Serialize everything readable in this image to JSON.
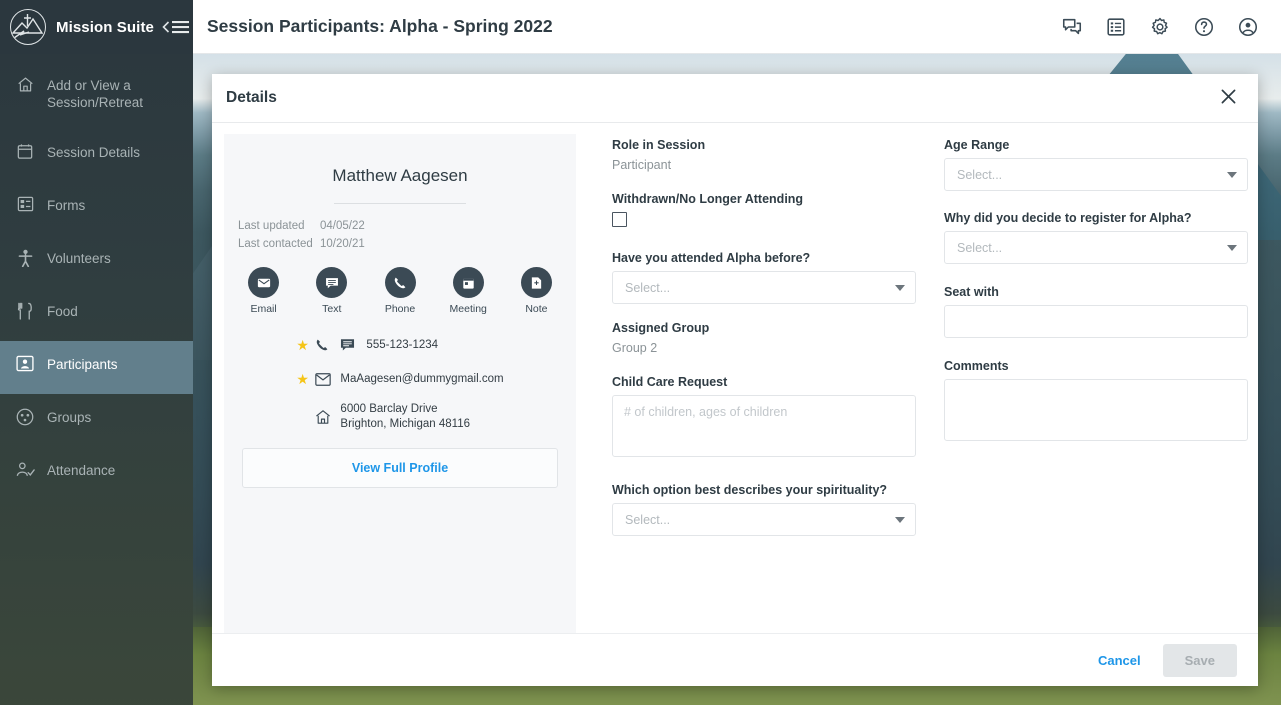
{
  "brand": {
    "name": "Mission Suite",
    "logo_icon": "mountain-cross-logo",
    "collapse_icon": "collapse-sidebar-icon"
  },
  "sidebar": {
    "items": [
      {
        "label": "Add or View a Session/Retreat",
        "icon": "home-icon",
        "active": false
      },
      {
        "label": "Session Details",
        "icon": "calendar-icon",
        "active": false
      },
      {
        "label": "Forms",
        "icon": "form-icon",
        "active": false
      },
      {
        "label": "Volunteers",
        "icon": "volunteer-person-icon",
        "active": false
      },
      {
        "label": "Food",
        "icon": "fork-knife-icon",
        "active": false
      },
      {
        "label": "Participants",
        "icon": "participant-badge-icon",
        "active": true
      },
      {
        "label": "Groups",
        "icon": "groups-circle-icon",
        "active": false
      },
      {
        "label": "Attendance",
        "icon": "attendance-check-icon",
        "active": false
      }
    ]
  },
  "header": {
    "title": "Session Participants: Alpha - Spring 2022",
    "actions": [
      {
        "icon": "chat-icon"
      },
      {
        "icon": "list-report-icon"
      },
      {
        "icon": "gear-icon"
      },
      {
        "icon": "help-icon"
      },
      {
        "icon": "account-icon"
      }
    ]
  },
  "modal": {
    "title": "Details",
    "close_icon": "close-icon",
    "footer": {
      "cancel_label": "Cancel",
      "save_label": "Save"
    }
  },
  "profile": {
    "name": "Matthew Aagesen",
    "meta": [
      {
        "key": "Last updated",
        "value": "04/05/22"
      },
      {
        "key": "Last contacted",
        "value": "10/20/21"
      }
    ],
    "quick_actions": [
      {
        "label": "Email",
        "icon": "email-icon"
      },
      {
        "label": "Text",
        "icon": "text-message-icon"
      },
      {
        "label": "Phone",
        "icon": "phone-icon"
      },
      {
        "label": "Meeting",
        "icon": "calendar-meeting-icon"
      },
      {
        "label": "Note",
        "icon": "note-icon"
      }
    ],
    "contacts": [
      {
        "starred": true,
        "icons": [
          "phone-icon",
          "text-message-icon"
        ],
        "text": "555-123-1234"
      },
      {
        "starred": true,
        "icons": [
          "envelope-icon"
        ],
        "text": "MaAagesen@dummygmail.com"
      },
      {
        "starred": false,
        "icons": [
          "home-address-icon"
        ],
        "line1": "6000 Barclay Drive",
        "line2": "Brighton, Michigan 48116"
      }
    ],
    "view_profile_label": "View Full Profile"
  },
  "form": {
    "middle": {
      "role_label": "Role in Session",
      "role_value": "Participant",
      "withdrawn_label": "Withdrawn/No Longer Attending",
      "withdrawn_checked": false,
      "attended_before_label": "Have you attended Alpha before?",
      "attended_before_value": "Select...",
      "assigned_group_label": "Assigned Group",
      "assigned_group_value": "Group 2",
      "child_care_label": "Child Care Request",
      "child_care_placeholder": "# of children, ages of children",
      "child_care_value": "",
      "spirituality_label": "Which option best describes your spirituality?",
      "spirituality_value": "Select..."
    },
    "right": {
      "age_range_label": "Age Range",
      "age_range_value": "Select...",
      "why_register_label": "Why did you decide to register for Alpha?",
      "why_register_value": "Select...",
      "seat_with_label": "Seat with",
      "seat_with_value": "",
      "seat_with_placeholder": "",
      "comments_label": "Comments",
      "comments_value": "",
      "comments_placeholder": ""
    }
  },
  "colors": {
    "sidebar_bg": "#2b373e",
    "sidebar_active": "#627f8c",
    "accent_link": "#1e96e8",
    "star": "#f5c518",
    "text_dark": "#2f3c44",
    "muted": "#8b9397"
  }
}
